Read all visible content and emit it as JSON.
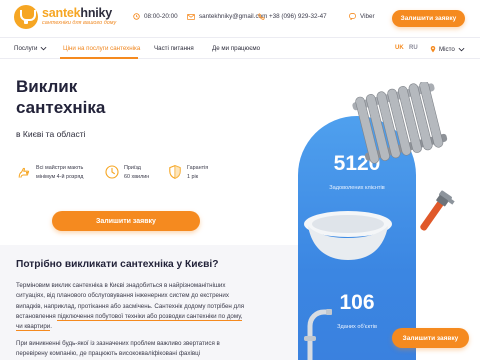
{
  "brand": {
    "name_part1": "santek",
    "name_part2": "hniky",
    "tagline": "сантехніки для вашого дому"
  },
  "header": {
    "hours": "08:00-20:00",
    "email": "santekhniky@gmail.com",
    "phone": "+38 (096) 929-32-47",
    "viber": "Viber",
    "cta": "Залишити заявку",
    "icons": [
      "clock-icon",
      "mail-icon",
      "phone-icon",
      "viber-icon"
    ]
  },
  "nav": {
    "items": [
      "Послуги",
      "Ціни на послуги сантехніка",
      "Частi питання",
      "Де ми працюємо"
    ],
    "lang_active": "UK",
    "lang_other": "RU",
    "city": "Місто"
  },
  "hero": {
    "title_line1": "Виклик",
    "title_line2": "сантехніка",
    "subtitle": "в Києві та області",
    "features": [
      {
        "line1": "Всі майстри мають",
        "line2": "мінімум 4-й розряд",
        "icon": "hand-tools-icon"
      },
      {
        "line1": "Приїзд",
        "line2": "60 хвилин",
        "icon": "clock-icon"
      },
      {
        "line1": "Гарантія",
        "line2": "1 рік",
        "icon": "shield-icon"
      }
    ],
    "cta": "Залишити заявку"
  },
  "stats": [
    {
      "value": "5120",
      "label": "Задоволених клієнтів"
    },
    {
      "value": "106",
      "label": "Зданих об'єктів"
    }
  ],
  "side_cta": "Залишити заявку",
  "section": {
    "title": "Потрібно викликати сантехніка у Києві?",
    "p1_a": "Терміновим виклик сантехніка в Києві знадобиться в найрізноманітніших ситуаціях, від планового обслуговування інженерних систем до екстрених випадків, наприклад, протікання або засмічень.  Сантехнік додому потрібен для встановлення ",
    "p1_hl": "підключення побутової техніки або розводки сантехніки по дому, чи квартири",
    "p1_b": ".",
    "p2": "При виникненні будь-якої із зазначених проблем важливо звертатися в перевірену компанію, де працюють висококваліфіковані фахівці"
  },
  "colors": {
    "accent": "#f58a1f",
    "panel_blue": "#3b86e2",
    "text_dark": "#23233a"
  }
}
